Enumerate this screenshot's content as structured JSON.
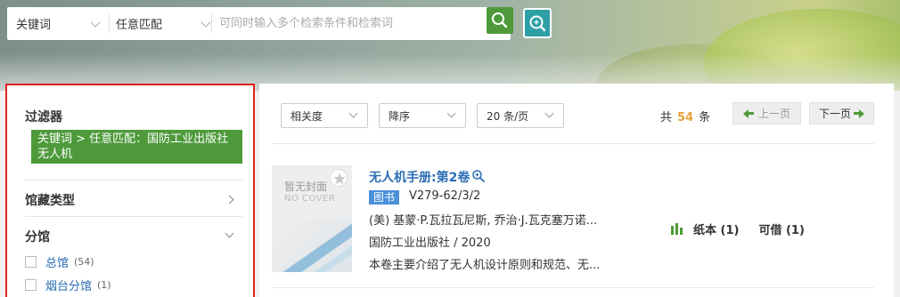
{
  "search": {
    "field_select": "关键词",
    "match_select": "任意匹配",
    "placeholder": "可同时输入多个检索条件和检索词",
    "icons": [
      "search-icon",
      "advanced-search-icon"
    ],
    "button_color": "#4e9a3b",
    "adv_color": "#2f9fa6"
  },
  "filter": {
    "title": "过滤器",
    "active_filter": "关键词 > 任意匹配：国防工业出版社无人机",
    "sections": {
      "collection_type": "馆藏类型",
      "branch": "分馆"
    },
    "branches": [
      {
        "name": "总馆",
        "count": "(54)"
      },
      {
        "name": "烟台分馆",
        "count": "(1)"
      }
    ]
  },
  "toolbar": {
    "sort_by": "相关度",
    "order": "降序",
    "page_size": "20 条/页",
    "total_prefix": "共",
    "total_count": "54",
    "total_suffix": "条",
    "prev_label": "上一页",
    "next_label": "下一页"
  },
  "result": {
    "cover_text": "暂无封面",
    "cover_text_en": "NO COVER",
    "title": "无人机手册:第2卷",
    "type_tag": "图书",
    "call_number": "V279-62/3/2",
    "authors": "(美) 基蒙·P.瓦拉瓦尼斯, 乔治·J.瓦克塞万诺...",
    "publisher": "国防工业出版社 / 2020",
    "summary": "本卷主要介绍了无人机设计原则和规范、无...",
    "holdings_print": "纸本 (1)",
    "holdings_loan": "可借 (1)"
  },
  "colors": {
    "accent_green": "#4e9a3b",
    "link_blue": "#2b6cb5",
    "count_orange": "#e8a23a",
    "highlight_border": "#e02020"
  }
}
